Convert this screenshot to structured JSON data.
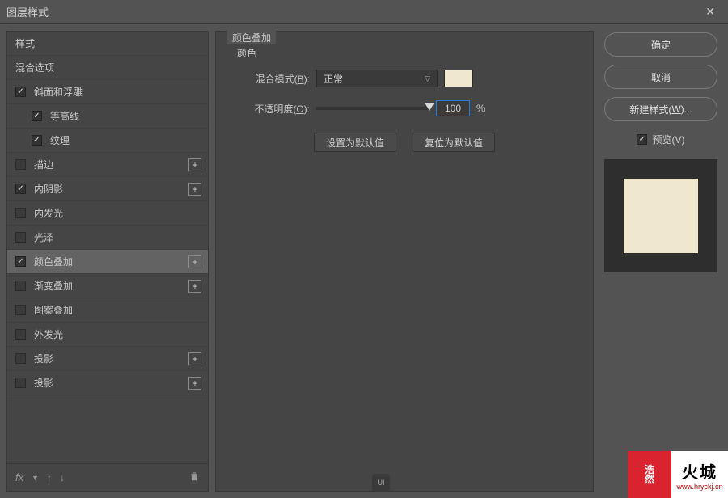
{
  "titlebar": {
    "title": "图层样式",
    "close": "✕"
  },
  "sidebar": {
    "styles_header": "样式",
    "blend_header": "混合选项",
    "items": [
      {
        "label": "斜面和浮雕",
        "checked": true,
        "plus": false,
        "indent": false
      },
      {
        "label": "等高线",
        "checked": true,
        "plus": false,
        "indent": true
      },
      {
        "label": "纹理",
        "checked": true,
        "plus": false,
        "indent": true
      },
      {
        "label": "描边",
        "checked": false,
        "plus": true,
        "indent": false
      },
      {
        "label": "内阴影",
        "checked": true,
        "plus": true,
        "indent": false
      },
      {
        "label": "内发光",
        "checked": false,
        "plus": false,
        "indent": false
      },
      {
        "label": "光泽",
        "checked": false,
        "plus": false,
        "indent": false
      },
      {
        "label": "颜色叠加",
        "checked": true,
        "plus": true,
        "indent": false,
        "selected": true
      },
      {
        "label": "渐变叠加",
        "checked": false,
        "plus": true,
        "indent": false
      },
      {
        "label": "图案叠加",
        "checked": false,
        "plus": false,
        "indent": false
      },
      {
        "label": "外发光",
        "checked": false,
        "plus": false,
        "indent": false
      },
      {
        "label": "投影",
        "checked": false,
        "plus": true,
        "indent": false
      },
      {
        "label": "投影",
        "checked": false,
        "plus": true,
        "indent": false
      }
    ],
    "footer_fx": "fx"
  },
  "main": {
    "group_title": "颜色叠加",
    "section_label": "颜色",
    "blend_mode_label_pre": "混合模式(",
    "blend_mode_key": "B",
    "blend_mode_label_post": "):",
    "blend_mode_value": "正常",
    "opacity_label_pre": "不透明度(",
    "opacity_key": "O",
    "opacity_label_post": "):",
    "opacity_value": "100",
    "opacity_unit": "%",
    "set_default": "设置为默认值",
    "reset_default": "复位为默认值",
    "swatch_color": "#efe8cf"
  },
  "right": {
    "ok": "确定",
    "cancel": "取消",
    "new_style_pre": "新建样式(",
    "new_style_key": "W",
    "new_style_post": ")...",
    "preview_pre": "预览(",
    "preview_key": "V",
    "preview_post": ")"
  },
  "watermark": {
    "center": "UI",
    "red1": "浩",
    "red2": "然",
    "white_big": "火城",
    "white_small": "www.hryckj.cn"
  }
}
